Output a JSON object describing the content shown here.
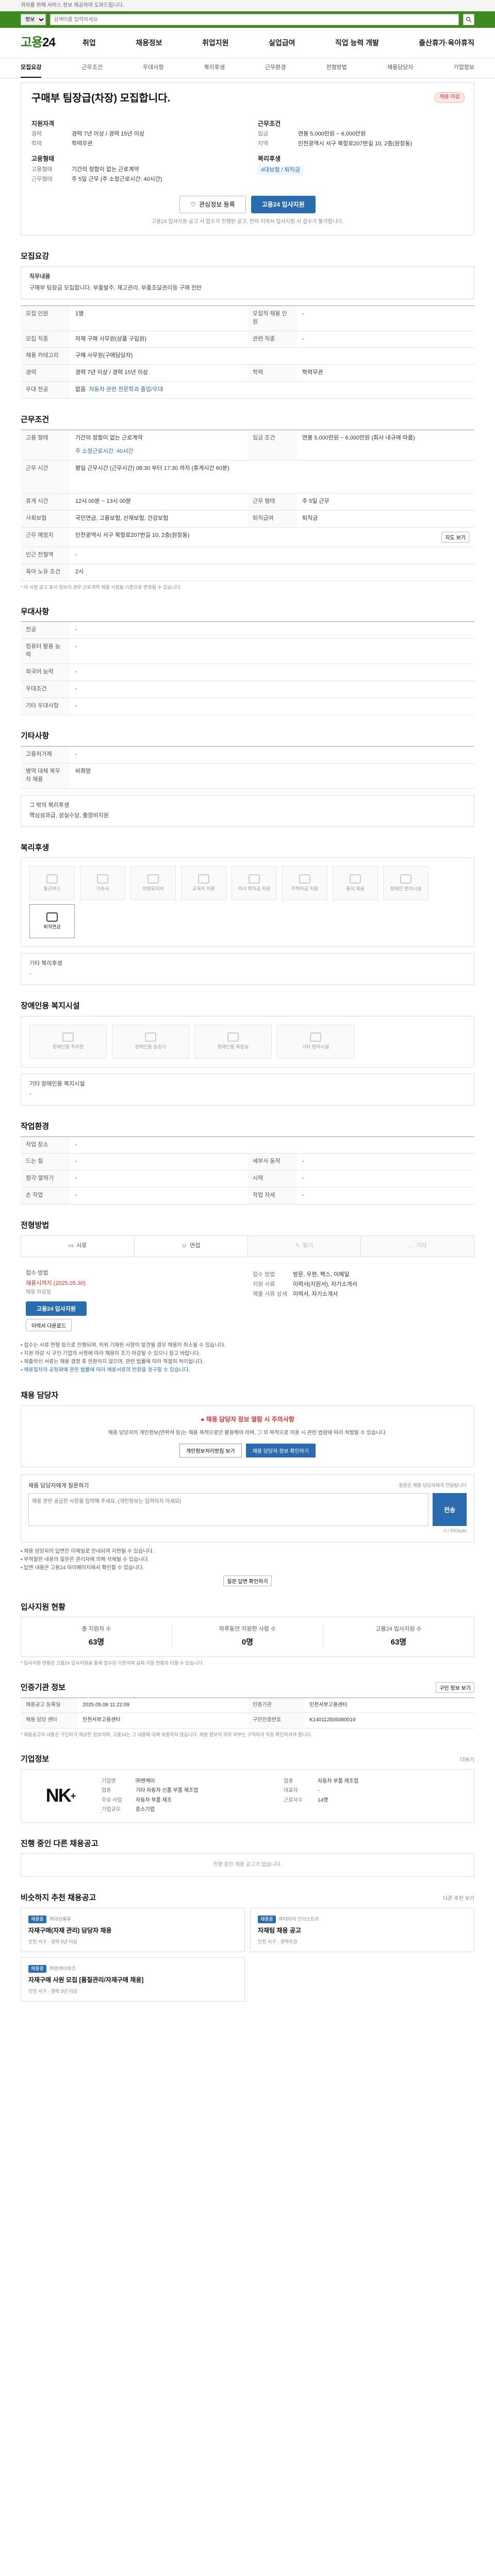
{
  "topbar": {
    "text": "귀하를 위해 서비스 정보 제공하여 도와드립니다."
  },
  "gov": {
    "select": "정보",
    "search_placeholder": "검색어를 입력하세요"
  },
  "header": {
    "logo_main": "고용",
    "logo_num": "24",
    "nav": [
      "취업",
      "채용정보",
      "취업지원",
      "실업급여",
      "직업 능력 개발",
      "출산휴가·육아휴직"
    ]
  },
  "tabs": [
    "모집요강",
    "근무조건",
    "우대사항",
    "복리후생",
    "근무환경",
    "전형방법",
    "채용담당자",
    "기업정보"
  ],
  "hero": {
    "title": "구매부 팀장급(차장) 모집합니다.",
    "badge": "채용 마감",
    "left": [
      {
        "group": "지원자격",
        "items": [
          {
            "k": "경력",
            "v": "경력 7년 이상 / 경력 15년 이상"
          },
          {
            "k": "학력",
            "v": "학력무관"
          }
        ]
      },
      {
        "group": "고용형태",
        "items": [
          {
            "k": "고용형태",
            "v": "기간의 정함이 없는 근로계약"
          },
          {
            "k": "근무형태",
            "v": "주 5일 근무 (주 소정근로시간: 40시간)"
          }
        ]
      }
    ],
    "right": [
      {
        "group": "근무조건",
        "items": [
          {
            "k": "임금",
            "v": "연봉 5,000만원 ~ 6,000만원"
          },
          {
            "k": "지역",
            "v": "인천광역시 서구 북항로207번길 10, 2층(원창동)"
          }
        ]
      },
      {
        "group": "복리후생",
        "items": [
          {
            "k": "",
            "v": "4대보험 / 퇴직금"
          }
        ]
      }
    ],
    "save_btn": "관심정보 등록",
    "apply_btn": "고용24 입사지원",
    "note": "고용24 입사지원 공고 시 접수가 진행된 공고, 전자 이력서 입사지원 시 접수가 불가합니다."
  },
  "recruit": {
    "title": "모집요강",
    "job_title": "직무내용",
    "job_desc": "구매부 팀장급 모집합니다. 부품발주, 재고관리, 부품조달관리등 구매 전반",
    "rows": [
      {
        "k": "모집 인원",
        "v": "1명",
        "k2": "모집직 채용 인원",
        "v2": "-"
      },
      {
        "k": "모집 직종",
        "v": "자재 구매 사무원(상품 구입원)",
        "k2": "관련 직종",
        "v2": "-"
      },
      {
        "k": "채용 카테고리",
        "v": "구매 사무원(구매담당자)",
        "k2": "",
        "v2": ""
      },
      {
        "k": "경력",
        "v": "경력 7년 이상 / 경력 15년 이상",
        "k2": "학력",
        "v2": "학력무관"
      },
      {
        "k": "우대 전공",
        "v": "없음",
        "k2": "비고",
        "v2": "자동차 관련 전문학과 졸업/우대"
      }
    ]
  },
  "conditions": {
    "title": "근무조건",
    "rows": [
      {
        "k": "고용 형태",
        "v": "기간의 정함이 없는 근로계약",
        "k2": "임금 조건",
        "v2": "연봉 5,000만원 ~ 6,000만원 (회사 내규에 따름)"
      },
      {
        "k": "",
        "v": "주 소정근로시간: 40시간",
        "k2": "",
        "v2": ""
      },
      {
        "k": "근무 시간",
        "v": "평일 근무시간 (근무시간) 08:30 부터 17:30 까지 (휴게시간 60분)",
        "k2": "",
        "v2": ""
      },
      {
        "k": "휴게 시간",
        "v": "12시 00분 ~ 13시 00분",
        "k2": "근무 형태",
        "v2": "주 5일 근무"
      },
      {
        "k": "사회보험",
        "v": "국민연금, 고용보험, 산재보험, 건강보험",
        "k2": "퇴직급여",
        "v2": "퇴직금"
      },
      {
        "k": "근무 예정지",
        "v": "인천광역시 서구 북항로207번길 10, 2층(원창동)",
        "k2": "",
        "v2": "",
        "btn": "지도 보기"
      },
      {
        "k": "인근 전철역",
        "v": "-",
        "k2": "",
        "v2": ""
      },
      {
        "k": "육아 노유 조건",
        "v": "2시",
        "k2": "",
        "v2": ""
      }
    ],
    "note": "* 이 사정 공고 표시 정보의 경우 근로계약 체결 시점을 기준으로 변경될 수 있습니다."
  },
  "preference": {
    "title": "우대사항",
    "rows": [
      {
        "k": "전공",
        "v": "-"
      },
      {
        "k": "컴퓨터 활용 능력",
        "v": "-"
      },
      {
        "k": "외국어 능력",
        "v": "-"
      },
      {
        "k": "우대조건",
        "v": "-"
      },
      {
        "k": "기타 우대사항",
        "v": "-"
      }
    ]
  },
  "etc": {
    "title": "기타사항",
    "rows": [
      {
        "k": "고용허가제",
        "v": "-"
      },
      {
        "k": "병역 대체 복무자 채용",
        "v": "비희망"
      }
    ],
    "other_title": "그 밖의 복리후생",
    "other_value": "핵심성과급, 성실수당, 출장비지원"
  },
  "welfare": {
    "title": "복리후생",
    "items": [
      {
        "label": "통근버스",
        "on": false
      },
      {
        "label": "기숙사",
        "on": false
      },
      {
        "label": "차량유지비",
        "on": false
      },
      {
        "label": "교육비 지원",
        "on": false
      },
      {
        "label": "자녀 학자금 지원",
        "on": false
      },
      {
        "label": "주택자금 지원",
        "on": false
      },
      {
        "label": "중식 제공",
        "on": false
      },
      {
        "label": "장애인 편의시설",
        "on": false
      },
      {
        "label": "퇴직연금",
        "on": true
      }
    ],
    "other_title": "기타 복리후생",
    "other_value": "-"
  },
  "disability": {
    "title": "장애인용 복지시설",
    "items": [
      "장애인용 주차장",
      "장애인용 승강기",
      "장애인용 화장실",
      "기타 편의시설"
    ],
    "other_title": "기타 장애인용 복지시설",
    "other_value": "-"
  },
  "workenv": {
    "title": "작업환경",
    "rows": [
      {
        "k": "작업 장소",
        "v": "-",
        "k2": "",
        "v2": ""
      },
      {
        "k": "드는 힘",
        "v": "-",
        "k2": "세부사 동작",
        "v2": "-"
      },
      {
        "k": "청각·말하기",
        "v": "-",
        "k2": "시력",
        "v2": "-"
      },
      {
        "k": "손 작업",
        "v": "-",
        "k2": "작업 자세",
        "v2": "-"
      }
    ]
  },
  "selection": {
    "title": "전형방법",
    "methods": [
      {
        "label": "서류",
        "on": true
      },
      {
        "label": "면접",
        "on": true
      },
      {
        "label": "필기",
        "on": false
      },
      {
        "label": "기타",
        "on": false
      }
    ],
    "rows": [
      {
        "k": "접수 방법",
        "v": "고용24 입사지원",
        "k2": "접수 방법",
        "v2": "방문, 우편, 팩스, 이메일"
      },
      {
        "k": "채용 마감일",
        "v": "채용시까지 (2025.05.30)",
        "k2": "지원 서류",
        "v2": "이력서(지원서), 자기소개서"
      },
      {
        "k": "",
        "v": "",
        "k2": "제출 서류 상세",
        "v2": "이력서, 자기소개서"
      }
    ],
    "apply_btn": "고용24 입사지원",
    "apply_btn2": "이력서 다운로드",
    "notes": [
      "• 접수는 서류 전형 등으로 진행되며, 허위 기재된 사항이 발견될 경우 채용이 취소될 수 있습니다.",
      "• 지원 마감 시 구인 기업의 사정에 따라 채용이 조기 마감될 수 있으니 참고 바랍니다.",
      "• 제출하신 서류는 채용 결정 후 반환하지 않으며, 관련 법률에 따라 적절히 처리됩니다.",
      "• 채용절차의 공정화에 관한 법률에 따라 채용서류의 반환을 청구할 수 있습니다."
    ]
  },
  "contact": {
    "title": "채용 담당자",
    "alert_title": "채용 담당자 정보 열람 시 주의사항",
    "alert_text": "채용 담당자의 개인정보(연락처 등)는 채용 목적으로만 활용해야 하며, 그 외 목적으로 이용 시 관련 법령에 따라 처벌될 수 있습니다.",
    "btn1": "개인정보처리방침 보기",
    "btn2": "채용 담당자 정보 확인하기",
    "inq_title": "채용 담당자에게 질문하기",
    "inq_right": "질문은 채용 담당자에게 전달됩니다",
    "placeholder": "채용 관련 궁금한 사항을 입력해 주세요. (개인정보는 입력하지 마세요)",
    "count": "0 / 500byte",
    "send": "전송",
    "notes": [
      "• 채용 담당자의 답변은 이메일로 안내되며 지연될 수 있습니다.",
      "• 부적절한 내용의 질문은 관리자에 의해 삭제될 수 있습니다.",
      "• 답변 내용은 고용24 마이페이지에서 확인할 수 있습니다."
    ],
    "notes_btn": "질문 답변 확인하기"
  },
  "applicants": {
    "title": "입사지원 현황",
    "stats": [
      {
        "label": "총 지원자 수",
        "value": "63명"
      },
      {
        "label": "하루동안 지원한 사람 수",
        "value": "0명"
      },
      {
        "label": "고용24 입사지원 수",
        "value": "63명"
      }
    ],
    "note": "* 입사지원 현황은 고용24 입사지원을 통해 접수된 기준이며 실제 지원 현황과 다를 수 있습니다."
  },
  "jobinfo": {
    "title": "인증기관 정보",
    "btn": "구인 정보 보기",
    "cells": [
      {
        "k": "채용공고 등록일",
        "v": "2025.05.08 11:22:09"
      },
      {
        "k": "인증기관",
        "v": "인천서부고용센터"
      },
      {
        "k": "채용 담당 센터",
        "v": "인천서부고용센터"
      },
      {
        "k": "구인인증번호",
        "v": "K140112505080019"
      }
    ],
    "note": "* 채용공고의 내용은 구인자가 제공한 정보이며, 고용24는 그 내용에 대해 보증하지 않습니다. 채용 정보의 허위 여부는 구직자가 직접 확인하셔야 합니다."
  },
  "company": {
    "title": "기업정보",
    "more": "더보기",
    "logo": "NK",
    "rows": [
      {
        "k": "기업명",
        "v": "㈜엔케이",
        "k2": "업종",
        "v2": "자동차 부품 제조업"
      },
      {
        "k": "업종",
        "v": "기타 자동차 신품 부품 제조업",
        "k2": "대표자",
        "v2": "-"
      },
      {
        "k": "주요 사업",
        "v": "자동차 부품 제조",
        "k2": "근로자수",
        "v2": "14명"
      },
      {
        "k": "기업규모",
        "v": "중소기업",
        "k2": "",
        "v2": ""
      }
    ]
  },
  "other_posts": {
    "title": "진행 중인 다른 채용공고",
    "empty": "진행 중인 채용 공고가 없습니다."
  },
  "recommend": {
    "title": "비슷하지 추천 채용공고",
    "more": "다른 추천 보기",
    "cards": [
      {
        "tag": "채용중",
        "company": "㈜대성물류",
        "title": "자재구매(자재 관리) 담당자 채용",
        "meta": "인천 서구 · 경력 5년 이상"
      },
      {
        "tag": "채용중",
        "company": "㈜대하이 인더스트리",
        "title": "자재팀 채용 공고",
        "meta": "인천 서구 · 경력무관"
      },
      {
        "tag": "채용중",
        "company": "㈜엔케이테크",
        "title": "자재구매 사원 모집 [품질관리/자재구매 채용]",
        "meta": "인천 서구 · 경력 3년 이상"
      }
    ]
  }
}
